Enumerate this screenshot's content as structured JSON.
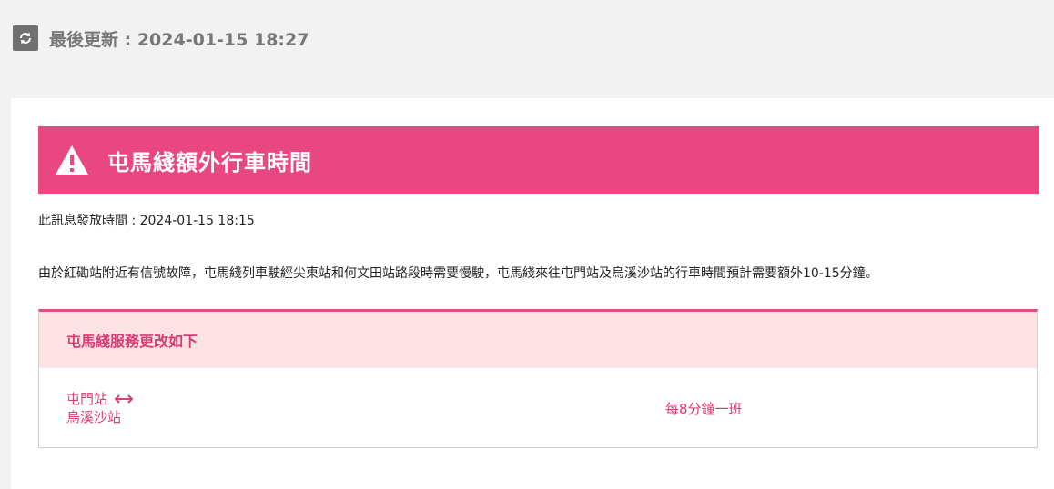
{
  "header": {
    "last_updated_label": "最後更新 : 2024-01-15 18:27"
  },
  "alert": {
    "title": "屯馬綫額外行車時間",
    "issue_time": "此訊息發放時間 : 2024-01-15 18:15",
    "message": "由於紅磡站附近有信號故障，屯馬綫列車駛經尖東站和何文田站路段時需要慢駛，屯馬綫來往屯門站及烏溪沙站的行車時間預計需要額外10-15分鐘。"
  },
  "service": {
    "heading": "屯馬綫服務更改如下",
    "route_from": "屯門站",
    "route_to": "烏溪沙站",
    "frequency": "每8分鐘一班"
  },
  "colors": {
    "accent": "#e94781",
    "header_bg": "#fde2e4",
    "text_pink": "#d83c74",
    "page_bg": "#f2f2f2"
  },
  "icons": {
    "refresh": "refresh-icon",
    "warning": "warning-icon",
    "bidirectional": "double-arrow-icon"
  }
}
